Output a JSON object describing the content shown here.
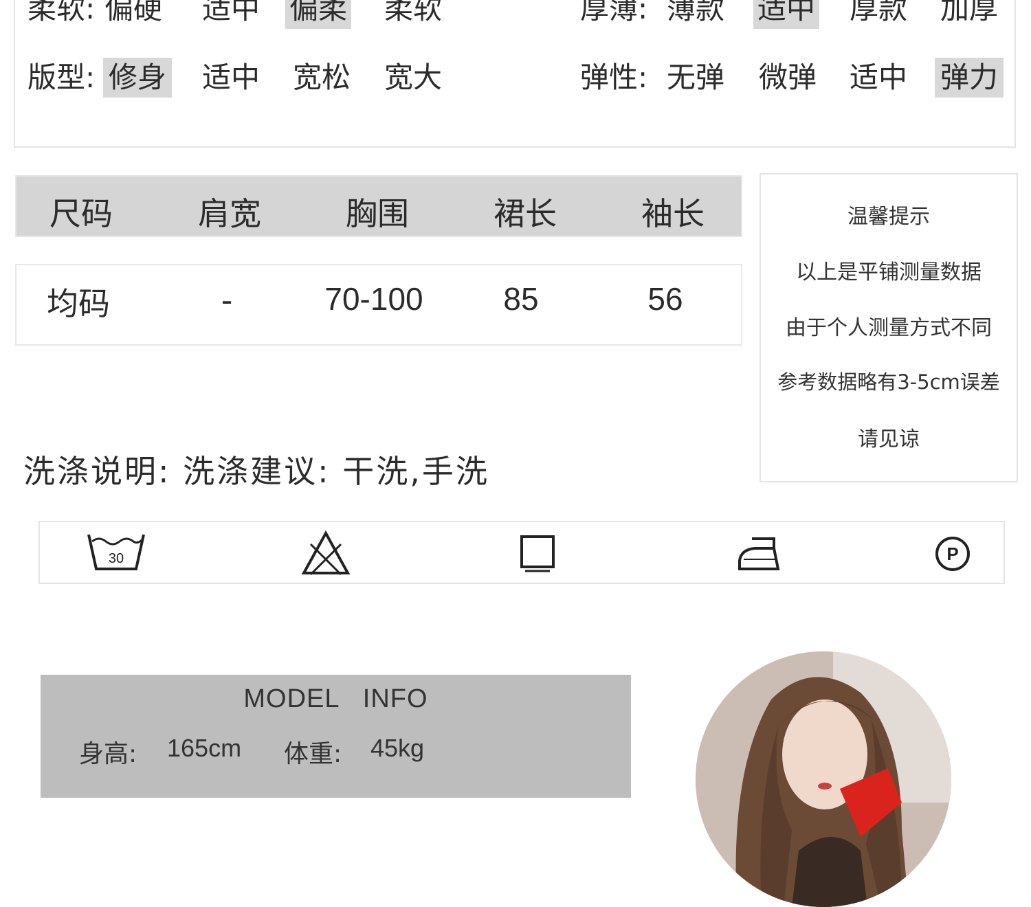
{
  "attributes": {
    "softness": {
      "label": "柔软:",
      "options": [
        "偏硬",
        "适中",
        "偏柔",
        "柔软"
      ],
      "selected": "偏柔"
    },
    "thickness": {
      "label": "厚薄:",
      "options": [
        "薄款",
        "适中",
        "厚款",
        "加厚"
      ],
      "selected": "适中"
    },
    "fit": {
      "label": "版型:",
      "options": [
        "修身",
        "适中",
        "宽松",
        "宽大"
      ],
      "selected": "修身"
    },
    "elasticity": {
      "label": "弹性:",
      "options": [
        "无弹",
        "微弹",
        "适中",
        "弹力"
      ],
      "selected": "弹力"
    }
  },
  "size_table": {
    "headers": [
      "尺码",
      "肩宽",
      "胸围",
      "裙长",
      "袖长"
    ],
    "rows": [
      [
        "均码",
        "-",
        "70-100",
        "85",
        "56"
      ]
    ]
  },
  "tips": {
    "title": "温馨提示",
    "lines": [
      "以上是平铺测量数据",
      "由于个人测量方式不同",
      "参考数据略有3-5cm误差",
      "请见谅"
    ]
  },
  "wash": {
    "text": "洗涤说明: 洗涤建议: 干洗,手洗",
    "icons": [
      "wash-30-icon",
      "no-bleach-icon",
      "tumble-dry-icon",
      "iron-icon",
      "dry-clean-p-icon"
    ],
    "wash_temp": "30",
    "dry_clean_letter": "P"
  },
  "model_info": {
    "title": "MODEL   INFO",
    "height_label": "身高:",
    "height_value": "165cm",
    "weight_label": "体重:",
    "weight_value": "45kg"
  },
  "colors": {
    "selected_bg": "#d8d8d8",
    "header_bg": "#d5d5d5",
    "model_bg": "#bdbdbd",
    "border": "#e4e4e4",
    "text": "#2b2b2b"
  }
}
